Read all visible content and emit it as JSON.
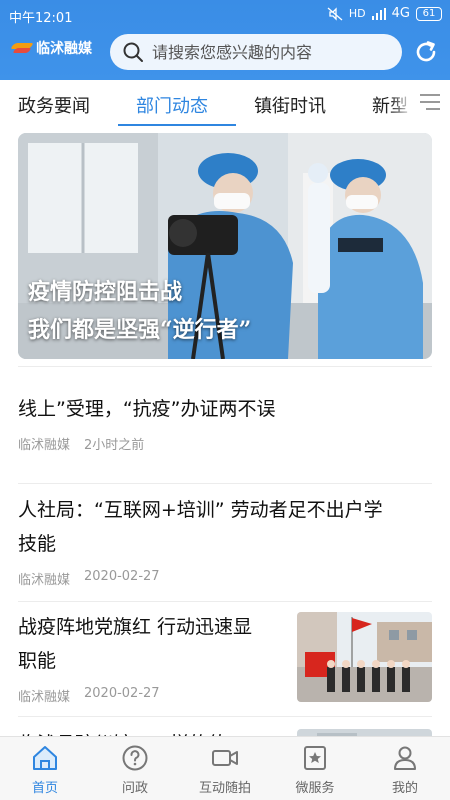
{
  "statusbar": {
    "time": "中午12:01",
    "network": "4G",
    "signal_label": "HD",
    "battery": "61"
  },
  "header": {
    "logo_text": "临沭融媒",
    "search_placeholder": "请搜索您感兴趣的内容"
  },
  "tabs": [
    {
      "label": "政务要闻",
      "active": false
    },
    {
      "label": "部门动态",
      "active": true
    },
    {
      "label": "镇街时讯",
      "active": false
    },
    {
      "label": "新型",
      "active": false
    }
  ],
  "banner": {
    "caption_line1": "疫情防控阻击战",
    "caption_line2": "我们都是坚强“逆行者”"
  },
  "news": [
    {
      "title": "线上”受理，“抗疫”办证两不误",
      "source": "临沭融媒",
      "time": "2小时之前"
    },
    {
      "title_line1": "人社局：“互联网+培训” 劳动者足不出户学",
      "title_line2": "技能",
      "source": "临沭融媒",
      "time": "2020-02-27"
    },
    {
      "title_line1": "战疫阵地党旗红 行动迅速显",
      "title_line2": "职能",
      "source": "临沭融媒",
      "time": "2020-02-27"
    },
    {
      "title": "临沭县殡仪馆……样的值",
      "source": "",
      "time": ""
    }
  ],
  "bottom_nav": [
    {
      "label": "首页",
      "icon": "home-icon",
      "active": true
    },
    {
      "label": "问政",
      "icon": "question-icon",
      "active": false
    },
    {
      "label": "互动随拍",
      "icon": "video-camera-icon",
      "active": false
    },
    {
      "label": "微服务",
      "icon": "star-bookmark-icon",
      "active": false
    },
    {
      "label": "我的",
      "icon": "user-icon",
      "active": false
    }
  ],
  "colors": {
    "header_blue": "#3b8fe6",
    "accent": "#2f86e0",
    "meta_gray": "#999999"
  }
}
